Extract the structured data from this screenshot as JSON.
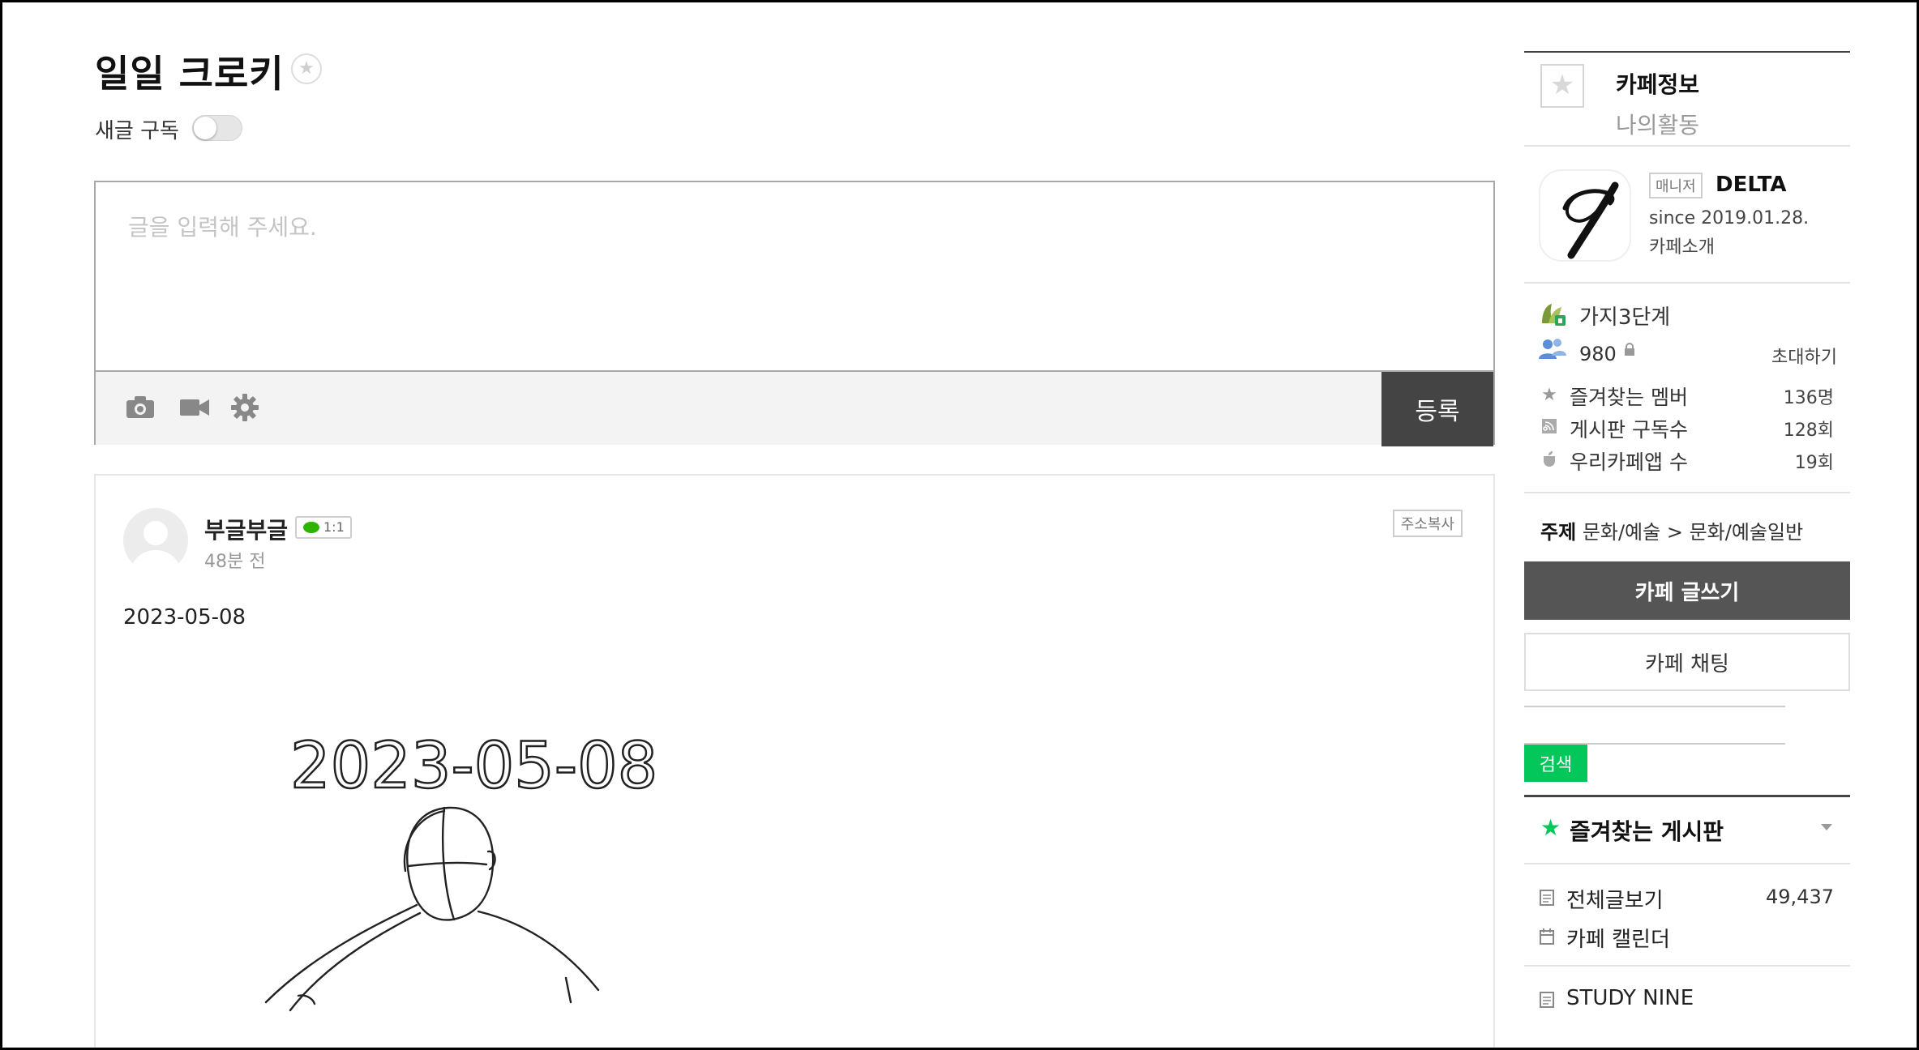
{
  "board": {
    "title": "일일 크로키",
    "subscribe_label": "새글 구독"
  },
  "editor": {
    "placeholder": "글을 입력해 주세요.",
    "submit_label": "등록"
  },
  "post": {
    "author": "부글부글",
    "chat_badge": "1:1",
    "time": "48분 전",
    "copy_label": "주소복사",
    "date_text": "2023-05-08",
    "sketch_caption": "2023-05-08"
  },
  "sidebar": {
    "tab_info": "카페정보",
    "tab_activity": "나의활동",
    "manager_badge": "매니저",
    "manager_name": "DELTA",
    "since": "since 2019.01.28.",
    "intro": "카페소개",
    "level": "가지3단계",
    "member_count": "980",
    "invite": "초대하기",
    "stats": [
      {
        "label": "즐겨찾는 멤버",
        "value": "136명"
      },
      {
        "label": "게시판 구독수",
        "value": "128회"
      },
      {
        "label": "우리카페앱 수",
        "value": "19회"
      }
    ],
    "topic_label": "주제",
    "topic_value": "문화/예술 > 문화/예술일반",
    "write_label": "카페 글쓰기",
    "chat_label": "카페 채팅",
    "search_label": "검색",
    "fav_board_label": "즐겨찾는 게시판",
    "menu": [
      {
        "label": "전체글보기",
        "value": "49,437"
      },
      {
        "label": "카페 캘린더",
        "value": ""
      },
      {
        "label": "STUDY NINE",
        "value": ""
      }
    ]
  },
  "colors": {
    "accent_green": "#03c75a",
    "dark_button": "#444444"
  },
  "icons": {
    "editor": [
      "camera-icon",
      "video-icon",
      "gear-icon"
    ],
    "stats": [
      "star-icon",
      "subscribe-icon",
      "app-icon"
    ]
  }
}
